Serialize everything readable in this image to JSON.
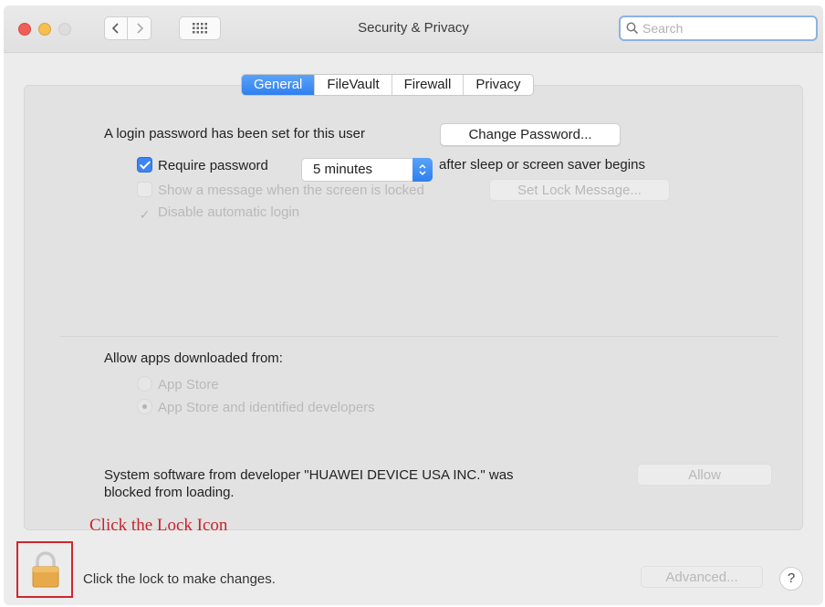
{
  "window": {
    "title": "Security & Privacy",
    "search_placeholder": "Search"
  },
  "tabs": [
    {
      "label": "General",
      "active": true
    },
    {
      "label": "FileVault",
      "active": false
    },
    {
      "label": "Firewall",
      "active": false
    },
    {
      "label": "Privacy",
      "active": false
    }
  ],
  "general": {
    "login_text": "A login password has been set for this user",
    "change_password_label": "Change Password...",
    "require_password_label": "Require password",
    "require_password_checked": true,
    "require_password_value": "5 minutes",
    "after_sleep_text": "after sleep or screen saver begins",
    "show_message_label": "Show a message when the screen is locked",
    "show_message_checked": false,
    "set_lock_message_label": "Set Lock Message...",
    "disable_autologin_label": "Disable automatic login",
    "disable_autologin_checked": true
  },
  "apps": {
    "heading": "Allow apps downloaded from:",
    "options": [
      {
        "label": "App Store",
        "selected": false
      },
      {
        "label": "App Store and identified developers",
        "selected": true
      }
    ]
  },
  "blocked": {
    "line1": "System software from developer \"HUAWEI DEVICE USA INC.\" was",
    "line2": "blocked from loading.",
    "allow_label": "Allow"
  },
  "annotation": {
    "text": "Click the Lock Icon",
    "color": "#c8232c"
  },
  "footer": {
    "lock_message": "Click the lock to make changes.",
    "advanced_label": "Advanced...",
    "help_label": "?"
  },
  "icons": {
    "back": "chevron-left-icon",
    "forward": "chevron-right-icon",
    "show_all": "grid-icon",
    "search": "search-icon",
    "lock": "lock-icon"
  },
  "colors": {
    "accent": "#3d85f2",
    "lock_highlight": "#d0262e"
  }
}
